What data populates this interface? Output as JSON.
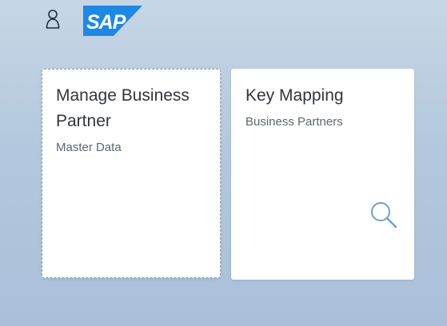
{
  "header": {
    "logo_text": "SAP",
    "logo_color": "#1e88e5",
    "user_icon": "user-icon"
  },
  "tiles": [
    {
      "title": "Manage Business Partner",
      "subtitle": "Master Data"
    },
    {
      "title": "Key Mapping",
      "subtitle": "Business Partners",
      "icon": "search-icon",
      "icon_color": "#6f9ed2"
    }
  ]
}
